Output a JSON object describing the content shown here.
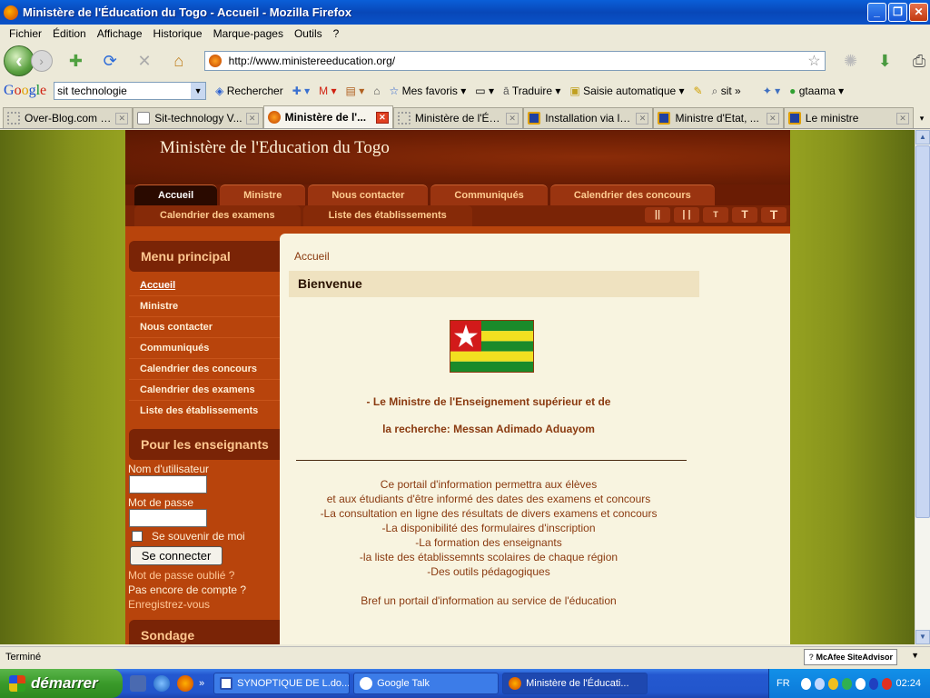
{
  "window": {
    "title": "Ministère de l'Éducation du Togo - Accueil - Mozilla Firefox"
  },
  "menubar": [
    "Fichier",
    "Édition",
    "Affichage",
    "Historique",
    "Marque-pages",
    "Outils",
    "?"
  ],
  "navbar": {
    "url": "http://www.ministereeducation.org/"
  },
  "googlebar": {
    "logo": "Google",
    "search_value": "sit technologie",
    "items": [
      "Rechercher",
      "Mes favoris",
      "Traduire",
      "Saisie automatique",
      "sit",
      "»",
      "gtaama"
    ]
  },
  "tabs": [
    {
      "label": "Over-Blog.com / ...",
      "icon_color": "#999999"
    },
    {
      "label": "Sit-technology V...",
      "icon_color": "#ffffff"
    },
    {
      "label": "Ministère de l'...",
      "icon_color": "#e08020",
      "active": true
    },
    {
      "label": "Ministère de l'Éco...",
      "icon_color": "#999999"
    },
    {
      "label": "Installation via le...",
      "icon_color": "#e0a000"
    },
    {
      "label": "Ministre d'Etat, ...",
      "icon_color": "#e0a000"
    },
    {
      "label": "Le ministre",
      "icon_color": "#e0a000"
    }
  ],
  "site": {
    "title": "Ministère de l'Education du Togo",
    "topnav": [
      "Accueil",
      "Ministre",
      "Nous contacter",
      "Communiqués",
      "Calendrier des concours"
    ],
    "subnav": [
      "Calendrier des examens",
      "Liste des établissements"
    ],
    "sizer": [
      "||",
      "| |",
      "T",
      "T",
      "T"
    ],
    "sidebar": {
      "menu_heading": "Menu principal",
      "menu_items": [
        "Accueil",
        "Ministre",
        "Nous contacter",
        "Communiqués",
        "Calendrier des concours",
        "Calendrier des examens",
        "Liste des établissements"
      ],
      "teachers_heading": "Pour les enseignants",
      "username_label": "Nom d'utilisateur",
      "password_label": "Mot de passe",
      "remember_label": "Se souvenir de moi",
      "login_button": "Se connecter",
      "forgot_link": "Mot de passe oublié ?",
      "no_account_link": "Pas encore de compte ?",
      "register_link": "Enregistrez-vous",
      "poll_heading": "Sondage"
    },
    "content": {
      "breadcrumb": "Accueil",
      "welcome": "Bienvenue",
      "minister_line1": "- Le Ministre de l'Enseignement supérieur et de",
      "minister_line2": "la recherche: Messan Adimado Aduayom",
      "paragraph": [
        "Ce portail d'information  permettra aux élèves",
        "et aux étudiants d'être informé des dates des examens et concours",
        "-La consultation en ligne des  résultats de divers examens et concours",
        "-La disponibilité des formulaires d'inscription",
        "-La formation des enseignants",
        "-la liste des établissemnts scolaires de chaque région",
        "-Des outils pédagogiques"
      ],
      "tagline": "Bref un portail d'information au service de l'éducation"
    }
  },
  "statusbar": {
    "text": "Terminé",
    "siteadvisor": "McAfee SiteAdvisor"
  },
  "taskbar": {
    "start": "démarrer",
    "buttons": [
      {
        "label": "SYNOPTIQUE DE L.do...",
        "icon_color": "#ffffff"
      },
      {
        "label": "Google Talk",
        "icon_color": "#ffffff"
      },
      {
        "label": "Ministère de l'Éducati...",
        "icon_color": "#e08020",
        "active": true
      }
    ],
    "lang": "FR",
    "clock": "02:24"
  }
}
